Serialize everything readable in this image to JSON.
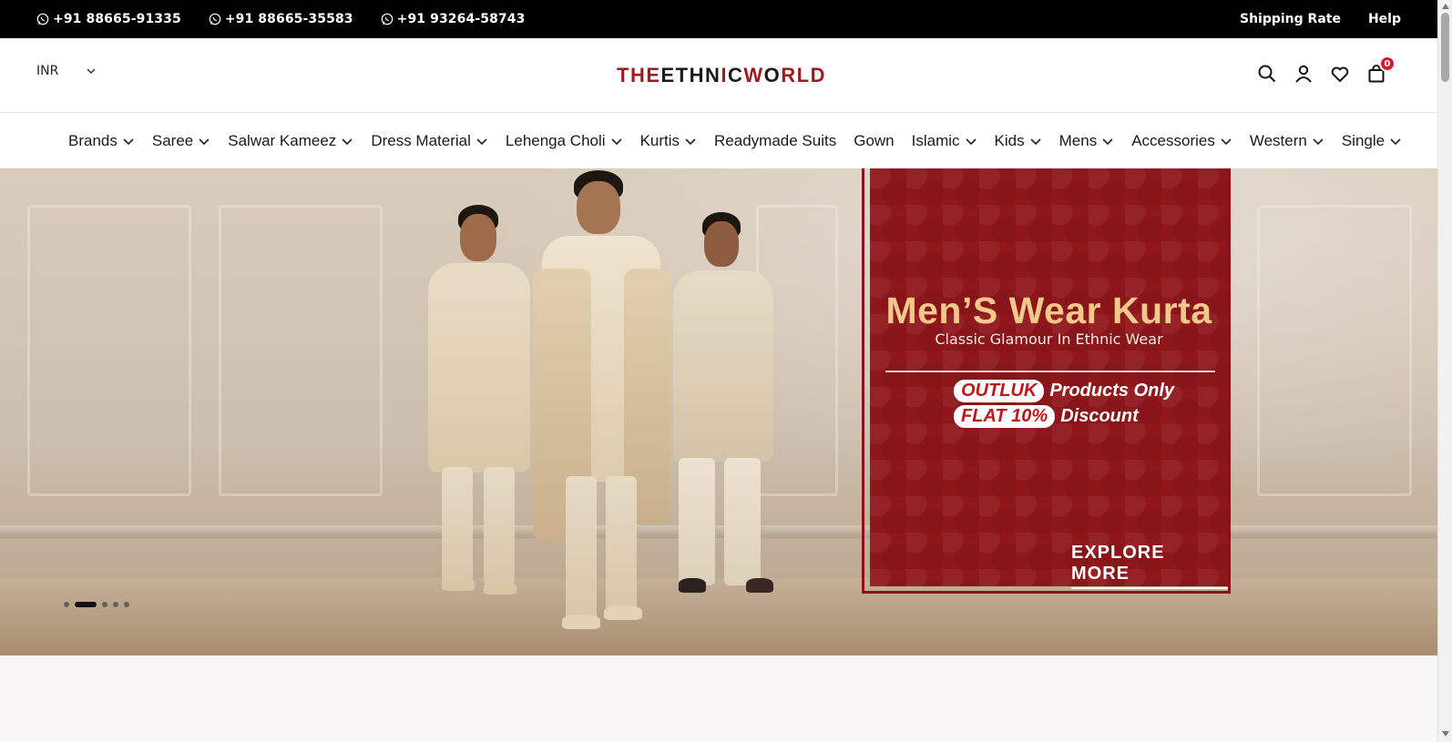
{
  "topbar": {
    "phones": [
      "+91 88665-91335",
      "+91 88665-35583",
      "+91 93264-58743"
    ],
    "links": [
      "Shipping Rate",
      "Help"
    ]
  },
  "header": {
    "currency": "INR",
    "logo_parts": [
      "THE",
      "ETHN",
      "I",
      "C",
      "W",
      "O",
      "RLD"
    ],
    "cart_count": "0"
  },
  "nav": {
    "items": [
      {
        "label": "Brands",
        "dropdown": true
      },
      {
        "label": "Saree",
        "dropdown": true
      },
      {
        "label": "Salwar Kameez",
        "dropdown": true
      },
      {
        "label": "Dress Material",
        "dropdown": true
      },
      {
        "label": "Lehenga Choli",
        "dropdown": true
      },
      {
        "label": "Kurtis",
        "dropdown": true
      },
      {
        "label": "Readymade Suits",
        "dropdown": false
      },
      {
        "label": "Gown",
        "dropdown": false
      },
      {
        "label": "Islamic",
        "dropdown": true
      },
      {
        "label": "Kids",
        "dropdown": true
      },
      {
        "label": "Mens",
        "dropdown": true
      },
      {
        "label": "Accessories",
        "dropdown": true
      },
      {
        "label": "Western",
        "dropdown": true
      },
      {
        "label": "Single",
        "dropdown": true
      }
    ]
  },
  "hero": {
    "title": "Men’S Wear Kurta",
    "subtitle": "Classic Glamour In Ethnic Wear",
    "row1_pill": "OUTLUK",
    "row1_text": "Products Only",
    "row2_pill": "FLAT 10%",
    "row2_text": "Discount",
    "cta": "EXPLORE MORE",
    "slides_total": 5,
    "active_slide": 2
  },
  "colors": {
    "topbar_bg": "#000000",
    "brand_red": "#9b1b1e",
    "promo_bg": "#8f161b",
    "promo_title": "#f2c98a",
    "badge": "#d8192a"
  }
}
